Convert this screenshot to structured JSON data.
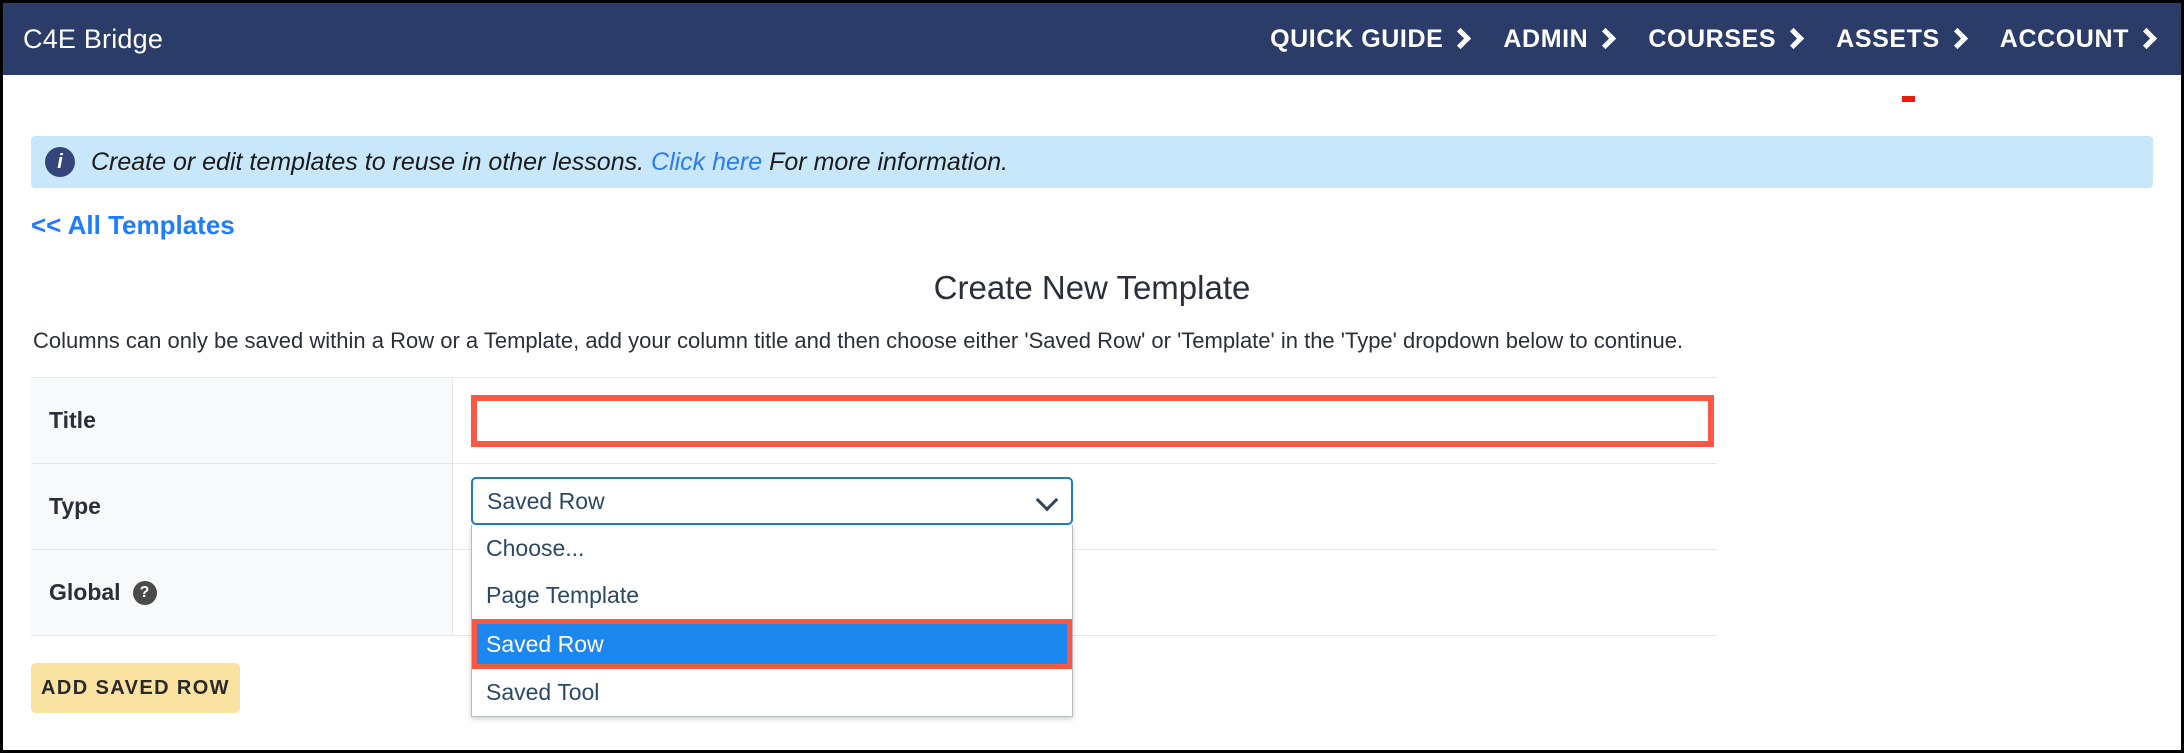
{
  "header": {
    "brand": "C4E Bridge",
    "nav": [
      {
        "label": "QUICK GUIDE",
        "icon": "chevron-right-icon"
      },
      {
        "label": "ADMIN",
        "icon": "chevron-right-icon"
      },
      {
        "label": "COURSES",
        "icon": "chevron-right-icon"
      },
      {
        "label": "ASSETS",
        "icon": "chevron-right-icon"
      },
      {
        "label": "ACCOUNT",
        "icon": "chevron-right-icon"
      }
    ]
  },
  "banner": {
    "icon": "info-icon",
    "icon_glyph": "i",
    "text_before": "Create or edit templates to reuse in other lessons. ",
    "link": "Click here",
    "text_after": " For more information.",
    "background": "#C8E7FB",
    "link_color": "#2B7BF3"
  },
  "back_link": "<< All Templates",
  "main": {
    "title": "Create New Template",
    "description": "Columns can only be saved within a Row or a Template, add your column title and then choose either 'Saved Row' or 'Template' in the 'Type' dropdown below to continue."
  },
  "form": {
    "rows": [
      {
        "label": "Title"
      },
      {
        "label": "Type"
      },
      {
        "label": "Global",
        "help_icon": "question-mark-icon",
        "help_glyph": "?"
      }
    ],
    "title_field": {
      "value": "",
      "placeholder": ""
    },
    "type_select": {
      "value": "Saved Row",
      "caret_icon": "chevron-down-icon",
      "options": [
        {
          "label": "Choose...",
          "selected": false
        },
        {
          "label": "Page Template",
          "selected": false
        },
        {
          "label": "Saved Row",
          "selected": true
        },
        {
          "label": "Saved Tool",
          "selected": false
        }
      ]
    },
    "global_checkbox": {
      "checked": false
    }
  },
  "actions": {
    "add_saved_row": "ADD SAVED ROW"
  },
  "annotations": {
    "highlight_color": "#FB5844",
    "selected_option_color": "#1D87F0",
    "header_color": "#2B3C68",
    "button_color": "#FAE3A0"
  }
}
